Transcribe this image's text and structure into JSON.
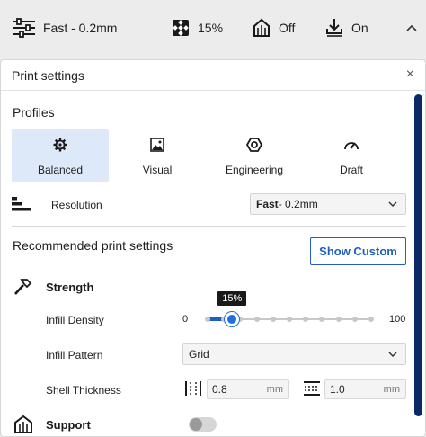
{
  "topbar": {
    "profile": "Fast - 0.2mm",
    "infill": "15%",
    "support": "Off",
    "adhesion": "On"
  },
  "panel": {
    "title": "Print settings",
    "close": "×",
    "profiles_label": "Profiles",
    "profiles": [
      {
        "label": "Balanced",
        "icon": "gear-icon",
        "selected": true
      },
      {
        "label": "Visual",
        "icon": "image-icon",
        "selected": false
      },
      {
        "label": "Engineering",
        "icon": "hex-nut-icon",
        "selected": false
      },
      {
        "label": "Draft",
        "icon": "gauge-icon",
        "selected": false
      }
    ],
    "resolution": {
      "label": "Resolution",
      "value_bold": "Fast",
      "value_rest": " - 0.2mm"
    },
    "recommended_label": "Recommended print settings",
    "show_custom": "Show Custom",
    "strength": {
      "title": "Strength",
      "infill_density": {
        "label": "Infill Density",
        "min": "0",
        "max": "100",
        "value_label": "15%",
        "value": 15,
        "ticks": 11
      },
      "infill_pattern": {
        "label": "Infill Pattern",
        "value": "Grid"
      },
      "shell_thickness": {
        "label": "Shell Thickness",
        "wall_value": "0.8",
        "top_bottom_value": "1.0",
        "unit": "mm"
      }
    },
    "support": {
      "title": "Support",
      "enabled": false
    }
  },
  "colors": {
    "accent": "#1f5fbf",
    "scrollbar": "#0a2a66",
    "selected_profile_bg": "#dde8f8"
  }
}
